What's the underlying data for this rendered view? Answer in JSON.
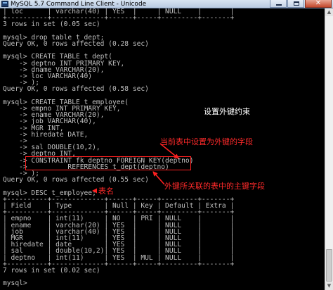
{
  "window": {
    "title": "MySQL 5.7 Command Line Client - Unicode",
    "close_glyph": "✕"
  },
  "console": {
    "lines": [
      "| loc      | varchar(40) | YES  |     | NULL    |       |",
      "+----------+-------------+------+-----+---------+-------+",
      "3 rows in set (0.05 sec)",
      "",
      "mysql> drop table t_dept;",
      "Query OK, 0 rows affected (0.28 sec)",
      "",
      "mysql> CREATE TABLE t_dept(",
      "    -> deptno INT PRIMARY KEY,",
      "    -> dname VARCHAR(20),",
      "    -> loc VARCHAR(40)",
      "    -> );",
      "Query OK, 0 rows affected (0.58 sec)",
      "",
      "mysql> CREATE TABLE t_employee(",
      "    -> empno INT PRIMARY KEY,",
      "    -> ename VARCHAR(20),",
      "    -> job VARCHAR(40),",
      "    -> MGR INT,",
      "    -> hiredate DATE,",
      "    ->",
      "    -> sal DOUBLE(10,2),",
      "    -> deptno INT,",
      "    -> CONSTRAINT fk_deptno FOREIGN KEY(deptno)",
      "    ->          REFERENCES t_dept(deptno)",
      "    -> );",
      "Query OK, 0 rows affected (0.55 sec)",
      "",
      "mysql> DESC t_employee;",
      "+----------+-------------+------+-----+---------+-------+",
      "| Field    | Type        | Null | Key | Default | Extra |",
      "+----------+-------------+------+-----+---------+-------+",
      "| empno    | int(11)     | NO   | PRI | NULL    |       |",
      "| ename    | varchar(20) | YES  |     | NULL    |       |",
      "| job      | varchar(40) | YES  |     | NULL    |       |",
      "| MGR      | int(11)     | YES  |     | NULL    |       |",
      "| hiredate | date        | YES  |     | NULL    |       |",
      "| sal      | double(10,2)| YES  |     | NULL    |       |",
      "| deptno   | int(11)     | YES  | MUL | NULL    |       |",
      "+----------+-------------+------+-----+---------+-------+",
      "7 rows in set (0.02 sec)",
      "",
      "mysql>"
    ]
  },
  "annotations": {
    "set_fk_constraint": "设置外键约束",
    "current_table_fk_field": "当前表中设置为外键的字段",
    "referenced_table_pk_field": "外键所关联的表中的主键字段",
    "table_name": "表名"
  },
  "colors": {
    "console_bg": "#000000",
    "console_text": "#c0c0c0",
    "annotation_red": "#ff2a2a",
    "annotation_white": "#ffffff"
  },
  "scrollbar": {
    "up_glyph": "▲",
    "down_glyph": "▼"
  }
}
